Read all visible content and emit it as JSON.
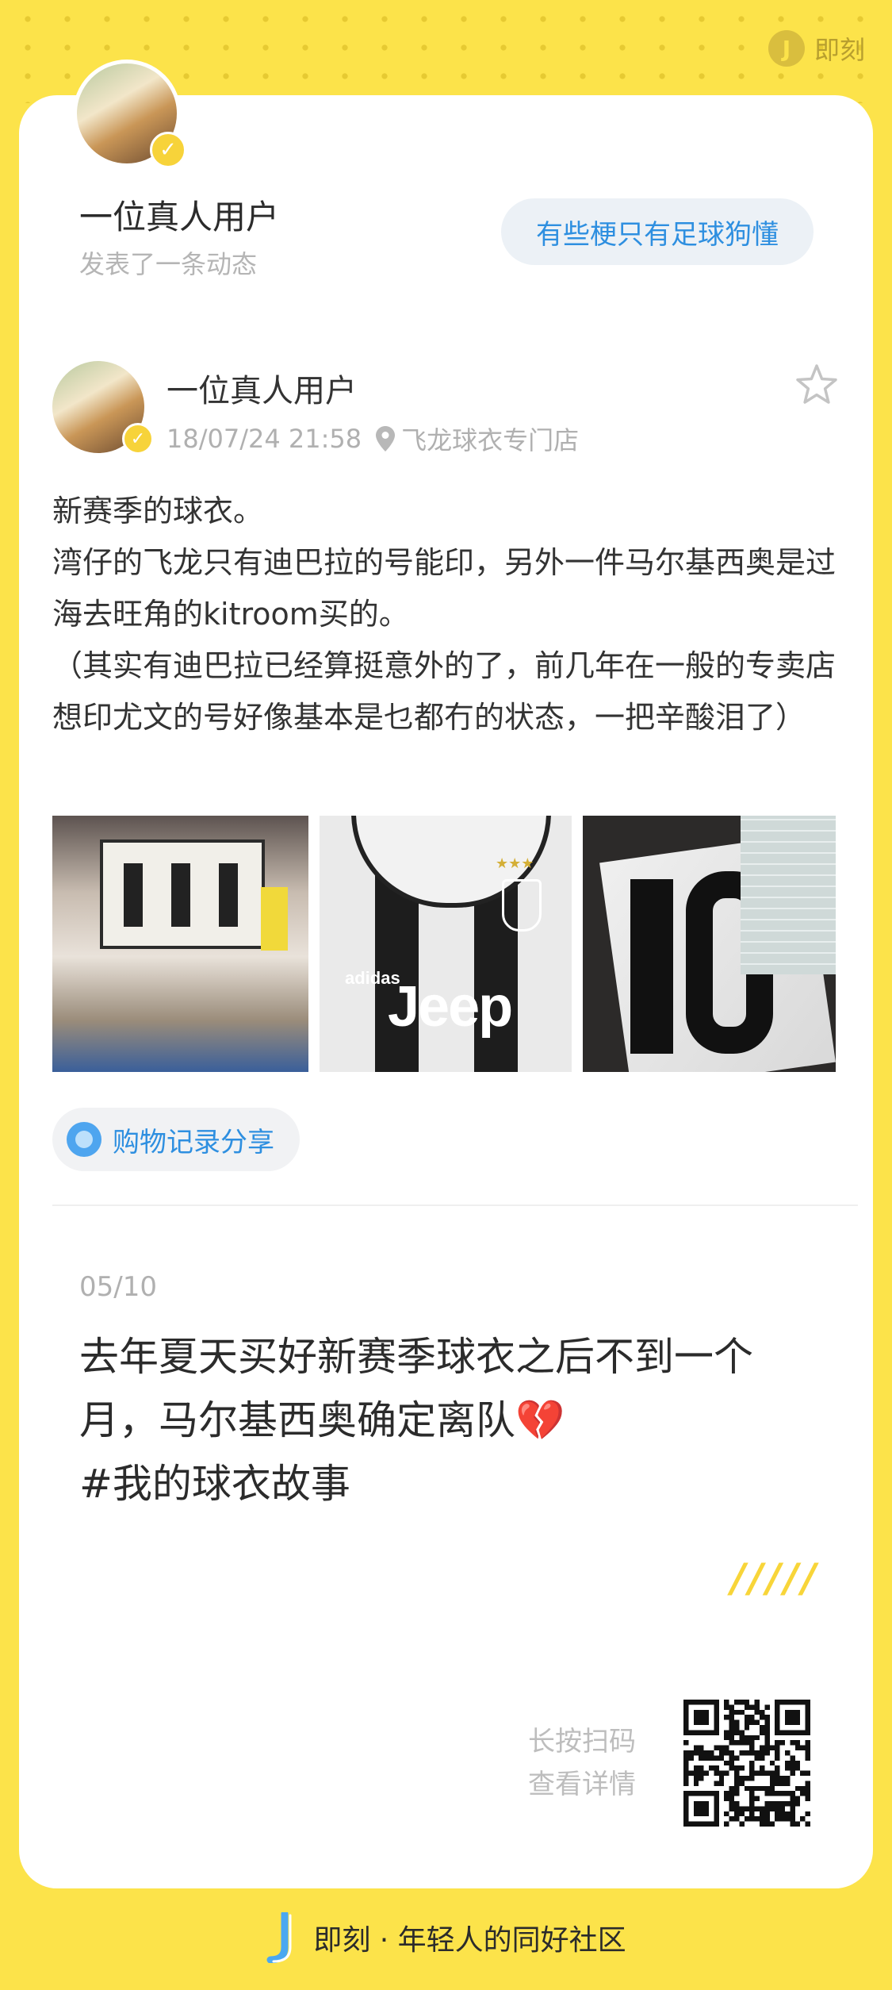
{
  "app": {
    "brand": "即刻",
    "slogan": "即刻 · 年轻人的同好社区"
  },
  "colors": {
    "background": "#FCE34A",
    "accent_blue": "#2E8FE0",
    "verified": "#F7D33A"
  },
  "poster": {
    "name": "一位真人用户",
    "subtitle": "发表了一条动态",
    "topic": "有些梗只有足球狗懂"
  },
  "post": {
    "user": "一位真人用户",
    "time": "18/07/24 21:58",
    "location": "飞龙球衣专门店",
    "text": "新赛季的球衣。\n湾仔的飞龙只有迪巴拉的号能印，另外一件马尔基西奥是过海去旺角的kitroom买的。\n（其实有迪巴拉已经算挺意外的了，前几年在一般的专卖店想印尤文的号好像基本是乜都冇的状态，一把辛酸泪了）",
    "tag": "购物记录分享"
  },
  "note": {
    "date": "05/10",
    "text": "去年夏天买好新赛季球衣之后不到一个月，马尔基西奥确定离队💔\n#我的球衣故事"
  },
  "qr": {
    "line1": "长按扫码",
    "line2": "查看详情"
  },
  "photo_text": {
    "adidas": "adidas",
    "jeep": "Jeep"
  },
  "icons": [
    "jike-logo-icon",
    "verified-check-icon",
    "location-pin-icon",
    "star-icon",
    "topic-dot-icon",
    "qr-code-icon"
  ]
}
